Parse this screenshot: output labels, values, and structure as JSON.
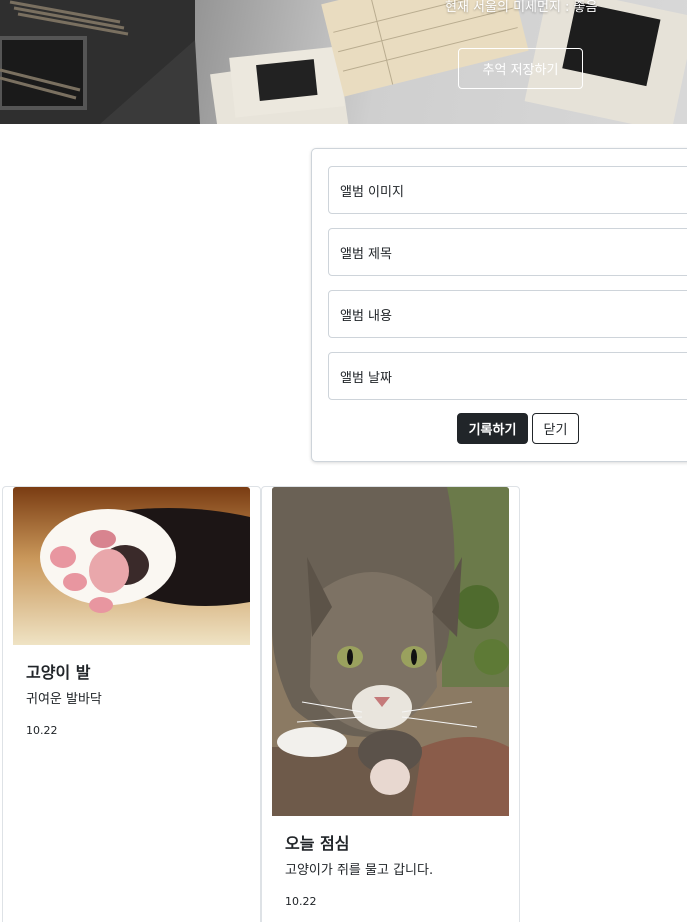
{
  "hero": {
    "air_quality_text": "현재 서울의 미세먼지 : 좋음",
    "save_memory_button": "추억 저장하기"
  },
  "form": {
    "fields": [
      {
        "label": "앨범 이미지"
      },
      {
        "label": "앨범 제목"
      },
      {
        "label": "앨범 내용"
      },
      {
        "label": "앨범 날짜"
      }
    ],
    "submit_label": "기록하기",
    "close_label": "닫기"
  },
  "cards": [
    {
      "title": "고양이 발",
      "text": "귀여운 발바닥",
      "date": "10.22"
    },
    {
      "title": "오늘 점심",
      "text": "고양이가 쥐를 물고 갑니다.",
      "date": "10.22"
    }
  ]
}
